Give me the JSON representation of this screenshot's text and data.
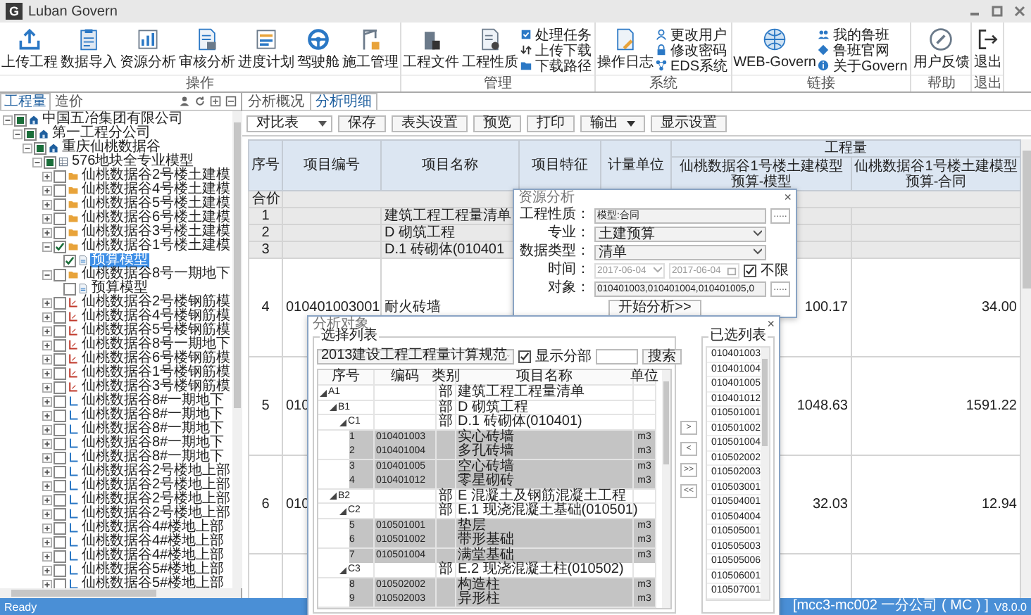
{
  "window": {
    "logo": "G",
    "title": "Luban Govern"
  },
  "ribbon": {
    "groups": [
      {
        "label": "操作",
        "large": [
          "上传工程",
          "数据导入",
          "资源分析",
          "审核分析",
          "进度计划",
          "驾驶舱",
          "施工管理"
        ]
      },
      {
        "label": "管理",
        "large": [
          "工程文件",
          "工程性质"
        ],
        "small": [
          "处理任务",
          "上传下载",
          "下载路径"
        ]
      },
      {
        "label": "系统",
        "large": [
          "操作日志"
        ],
        "small": [
          "更改用户",
          "修改密码",
          "EDS系统"
        ]
      },
      {
        "label": "链接",
        "large": [
          "WEB-Govern"
        ],
        "small": [
          "我的鲁班",
          "鲁班官网",
          "关于Govern"
        ]
      },
      {
        "label": "帮助",
        "large": [
          "用户反馈"
        ]
      },
      {
        "label": "退出",
        "large": [
          "退出"
        ]
      }
    ]
  },
  "project_tree": {
    "tabs": [
      {
        "label": "工程量",
        "selected": true
      },
      {
        "label": "造价",
        "selected": false
      }
    ],
    "nodes": [
      {
        "label": "中国五冶集团有限公司",
        "kind": "company",
        "partial": true,
        "expanded": true,
        "selected": false,
        "children": [
          {
            "label": "第一工程分公司",
            "kind": "company",
            "partial": true,
            "expanded": true,
            "selected": false,
            "children": [
              {
                "label": "重庆仙桃数据谷",
                "kind": "company",
                "partial": true,
                "expanded": true,
                "selected": false,
                "children": [
                  {
                    "label": "576地块全专业模型",
                    "kind": "model",
                    "partial": true,
                    "expanded": true,
                    "selected": false,
                    "children": [
                      {
                        "label": "仙桃数据谷2号楼土建模",
                        "kind": "folder",
                        "checked": false,
                        "expanded": false,
                        "selected": false
                      },
                      {
                        "label": "仙桃数据谷4号楼土建模",
                        "kind": "folder",
                        "checked": false,
                        "expanded": false,
                        "selected": false
                      },
                      {
                        "label": "仙桃数据谷5号楼土建模",
                        "kind": "folder",
                        "checked": false,
                        "expanded": false,
                        "selected": false
                      },
                      {
                        "label": "仙桃数据谷6号楼土建模",
                        "kind": "folder",
                        "checked": false,
                        "expanded": false,
                        "selected": false
                      },
                      {
                        "label": "仙桃数据谷3号楼土建模",
                        "kind": "folder",
                        "checked": false,
                        "expanded": false,
                        "selected": false
                      },
                      {
                        "label": "仙桃数据谷1号楼土建模",
                        "kind": "folder",
                        "checked": true,
                        "expanded": true,
                        "selected": false,
                        "children": [
                          {
                            "label": "预算模型",
                            "kind": "budget",
                            "checked": true,
                            "selected": true
                          }
                        ]
                      },
                      {
                        "label": "仙桃数据谷8号一期地下",
                        "kind": "folder",
                        "checked": false,
                        "expanded": true,
                        "selected": false,
                        "children": [
                          {
                            "label": "预算模型",
                            "kind": "budget",
                            "checked": false,
                            "selected": false
                          }
                        ]
                      },
                      {
                        "label": "仙桃数据谷2号楼钢筋模",
                        "kind": "steel",
                        "checked": false,
                        "expanded": false,
                        "selected": false
                      },
                      {
                        "label": "仙桃数据谷4号楼钢筋模",
                        "kind": "steel",
                        "checked": false,
                        "expanded": false,
                        "selected": false
                      },
                      {
                        "label": "仙桃数据谷5号楼钢筋模",
                        "kind": "steel",
                        "checked": false,
                        "expanded": false,
                        "selected": false
                      },
                      {
                        "label": "仙桃数据谷8号一期地下",
                        "kind": "steel",
                        "checked": false,
                        "expanded": false,
                        "selected": false
                      },
                      {
                        "label": "仙桃数据谷6号楼钢筋模",
                        "kind": "steel",
                        "checked": false,
                        "expanded": false,
                        "selected": false
                      },
                      {
                        "label": "仙桃数据谷1号楼钢筋模",
                        "kind": "steel",
                        "checked": false,
                        "expanded": false,
                        "selected": false
                      },
                      {
                        "label": "仙桃数据谷3号楼钢筋模",
                        "kind": "steel",
                        "checked": false,
                        "expanded": false,
                        "selected": false
                      },
                      {
                        "label": "仙桃数据谷8#一期地下",
                        "kind": "mep",
                        "checked": false,
                        "expanded": false,
                        "selected": false
                      },
                      {
                        "label": "仙桃数据谷8#一期地下",
                        "kind": "mep",
                        "checked": false,
                        "expanded": false,
                        "selected": false
                      },
                      {
                        "label": "仙桃数据谷8#一期地下",
                        "kind": "mep",
                        "checked": false,
                        "expanded": false,
                        "selected": false
                      },
                      {
                        "label": "仙桃数据谷8#一期地下",
                        "kind": "mep",
                        "checked": false,
                        "expanded": false,
                        "selected": false
                      },
                      {
                        "label": "仙桃数据谷8#一期地下",
                        "kind": "mep",
                        "checked": false,
                        "expanded": false,
                        "selected": false
                      },
                      {
                        "label": "仙桃数据谷2号楼地上部",
                        "kind": "mep",
                        "checked": false,
                        "expanded": false,
                        "selected": false
                      },
                      {
                        "label": "仙桃数据谷2号楼地上部",
                        "kind": "mep",
                        "checked": false,
                        "expanded": false,
                        "selected": false
                      },
                      {
                        "label": "仙桃数据谷2号楼地上部",
                        "kind": "mep",
                        "checked": false,
                        "expanded": false,
                        "selected": false
                      },
                      {
                        "label": "仙桃数据谷2号楼地上部",
                        "kind": "mep",
                        "checked": false,
                        "expanded": false,
                        "selected": false
                      },
                      {
                        "label": "仙桃数据谷4#楼地上部",
                        "kind": "mep",
                        "checked": false,
                        "expanded": false,
                        "selected": false
                      },
                      {
                        "label": "仙桃数据谷4#楼地上部",
                        "kind": "mep",
                        "checked": false,
                        "expanded": false,
                        "selected": false
                      },
                      {
                        "label": "仙桃数据谷4#楼地上部",
                        "kind": "mep",
                        "checked": false,
                        "expanded": false,
                        "selected": false
                      },
                      {
                        "label": "仙桃数据谷5#楼地上部",
                        "kind": "mep",
                        "checked": false,
                        "expanded": false,
                        "selected": false
                      },
                      {
                        "label": "仙桃数据谷5#楼地上部",
                        "kind": "mep",
                        "checked": false,
                        "expanded": false,
                        "selected": false
                      }
                    ]
                  }
                ]
              }
            ]
          }
        ]
      }
    ]
  },
  "analysis_view": {
    "tabs": [
      {
        "label": "分析概况",
        "selected": false
      },
      {
        "label": "分析明细",
        "selected": true
      }
    ],
    "toolbar": [
      {
        "kind": "select",
        "label": "对比表"
      },
      {
        "kind": "button",
        "label": "保存"
      },
      {
        "kind": "button",
        "label": "表头设置"
      },
      {
        "kind": "button",
        "label": "预览"
      },
      {
        "kind": "button",
        "label": "打印"
      },
      {
        "kind": "menu",
        "label": "输出"
      },
      {
        "kind": "button",
        "label": "显示设置"
      }
    ],
    "table": {
      "columns": [
        "序号",
        "项目编号",
        "项目名称",
        "项目特征",
        "计量单位"
      ],
      "group": {
        "label": "工程量",
        "columns": [
          {
            "lines": [
              "仙桃数据谷1号楼土建模型",
              "预算-模型"
            ]
          },
          {
            "lines": [
              "仙桃数据谷1号楼土建模型",
              "预算-合同"
            ]
          }
        ]
      },
      "rows": [
        {
          "kind": "total",
          "seq": "合价"
        },
        {
          "kind": "group",
          "seq": "1",
          "name": "建筑工程工程量清单"
        },
        {
          "kind": "group",
          "seq": "2",
          "name": "D 砌筑工程"
        },
        {
          "kind": "group",
          "seq": "3",
          "name": "D.1 砖砌体(010401"
        },
        {
          "kind": "item",
          "seq": "4",
          "code": "010401003001",
          "name": "耐火砖墙",
          "model": "100.17",
          "contract": "34.00"
        },
        {
          "kind": "item",
          "seq": "5",
          "code": "010",
          "model": "1048.63",
          "contract": "1591.22"
        },
        {
          "kind": "item",
          "seq": "6",
          "code": "010",
          "model": "32.03",
          "contract": "12.94"
        }
      ]
    }
  },
  "resource_dialog": {
    "title": "资源分析",
    "close": "×",
    "fields": [
      {
        "kind": "picker",
        "label": "工程性质：",
        "value": "模型:合同",
        "button": "....."
      },
      {
        "kind": "select",
        "label": "专业：",
        "value": "土建预算"
      },
      {
        "kind": "select",
        "label": "数据类型：",
        "value": "清单"
      },
      {
        "kind": "dates",
        "label": "时间：",
        "from": "2017-06-04",
        "to": "2017-06-04",
        "disabled": true,
        "checkbox": {
          "label": "不限",
          "checked": true
        }
      },
      {
        "kind": "picker",
        "label": "对象：",
        "value": "010401003,010401004,010401005,0",
        "button": "....."
      }
    ],
    "action": "开始分析>>"
  },
  "object_dialog": {
    "title": "分析对象",
    "close": "×",
    "picker": {
      "legend": "选择列表",
      "standard": "2013建设工程工程量计算规范",
      "show_sections": {
        "label": "显示分部",
        "checked": true
      },
      "search_button": "搜索",
      "columns": [
        "序号",
        "编码",
        "类别",
        "项目名称",
        "单位"
      ],
      "rows": [
        {
          "seq": "A1",
          "category": "部",
          "name": "建筑工程工程量清单",
          "expanded": true,
          "selected": false,
          "children": [
            {
              "seq": "B1",
              "category": "部",
              "name": "D 砌筑工程",
              "expanded": true,
              "selected": false,
              "children": [
                {
                  "seq": "C1",
                  "category": "部",
                  "name": "D.1 砖砌体(010401)",
                  "expanded": true,
                  "selected": false,
                  "children": [
                    {
                      "seq": "1",
                      "code": "010401003",
                      "name": "实心砖墙",
                      "unit": "m3",
                      "selected": true
                    },
                    {
                      "seq": "2",
                      "code": "010401004",
                      "name": "多孔砖墙",
                      "unit": "m3",
                      "selected": true
                    },
                    {
                      "seq": "3",
                      "code": "010401005",
                      "name": "空心砖墙",
                      "unit": "m3",
                      "selected": true
                    },
                    {
                      "seq": "4",
                      "code": "010401012",
                      "name": "零星砌砖",
                      "unit": "m3",
                      "selected": true
                    }
                  ]
                }
              ]
            },
            {
              "seq": "B2",
              "category": "部",
              "name": "E 混凝土及钢筋混凝土工程",
              "expanded": true,
              "selected": false,
              "children": [
                {
                  "seq": "C2",
                  "category": "部",
                  "name": "E.1 现浇混凝土基础(010501)",
                  "expanded": true,
                  "selected": false,
                  "children": [
                    {
                      "seq": "5",
                      "code": "010501001",
                      "name": "垫层",
                      "unit": "m3",
                      "selected": true
                    },
                    {
                      "seq": "6",
                      "code": "010501002",
                      "name": "带形基础",
                      "unit": "m3",
                      "selected": true
                    },
                    {
                      "seq": "7",
                      "code": "010501004",
                      "name": "满堂基础",
                      "unit": "m3",
                      "selected": true
                    }
                  ]
                },
                {
                  "seq": "C3",
                  "category": "部",
                  "name": "E.2 现浇混凝土柱(010502)",
                  "expanded": true,
                  "selected": false,
                  "children": [
                    {
                      "seq": "8",
                      "code": "010502002",
                      "name": "构造柱",
                      "unit": "m3",
                      "selected": true
                    },
                    {
                      "seq": "9",
                      "code": "010502003",
                      "name": "异形柱",
                      "unit": "m3",
                      "selected": true
                    }
                  ]
                }
              ]
            }
          ]
        }
      ]
    },
    "transfer": [
      ">",
      "<",
      ">>",
      "<<"
    ],
    "chosen": {
      "legend": "已选列表",
      "items": [
        "010401003",
        "010401004",
        "010401005",
        "010401012",
        "010501001",
        "010501002",
        "010501004",
        "010502002",
        "010502003",
        "010503001",
        "010504001",
        "010504004",
        "010505001",
        "010505003",
        "010505006",
        "010506001",
        "010507001"
      ]
    }
  },
  "status_bar": {
    "state": "Ready",
    "user": "[mcc3-mc002 一分公司 ( MC ) ]",
    "version": "V8.0.0"
  }
}
